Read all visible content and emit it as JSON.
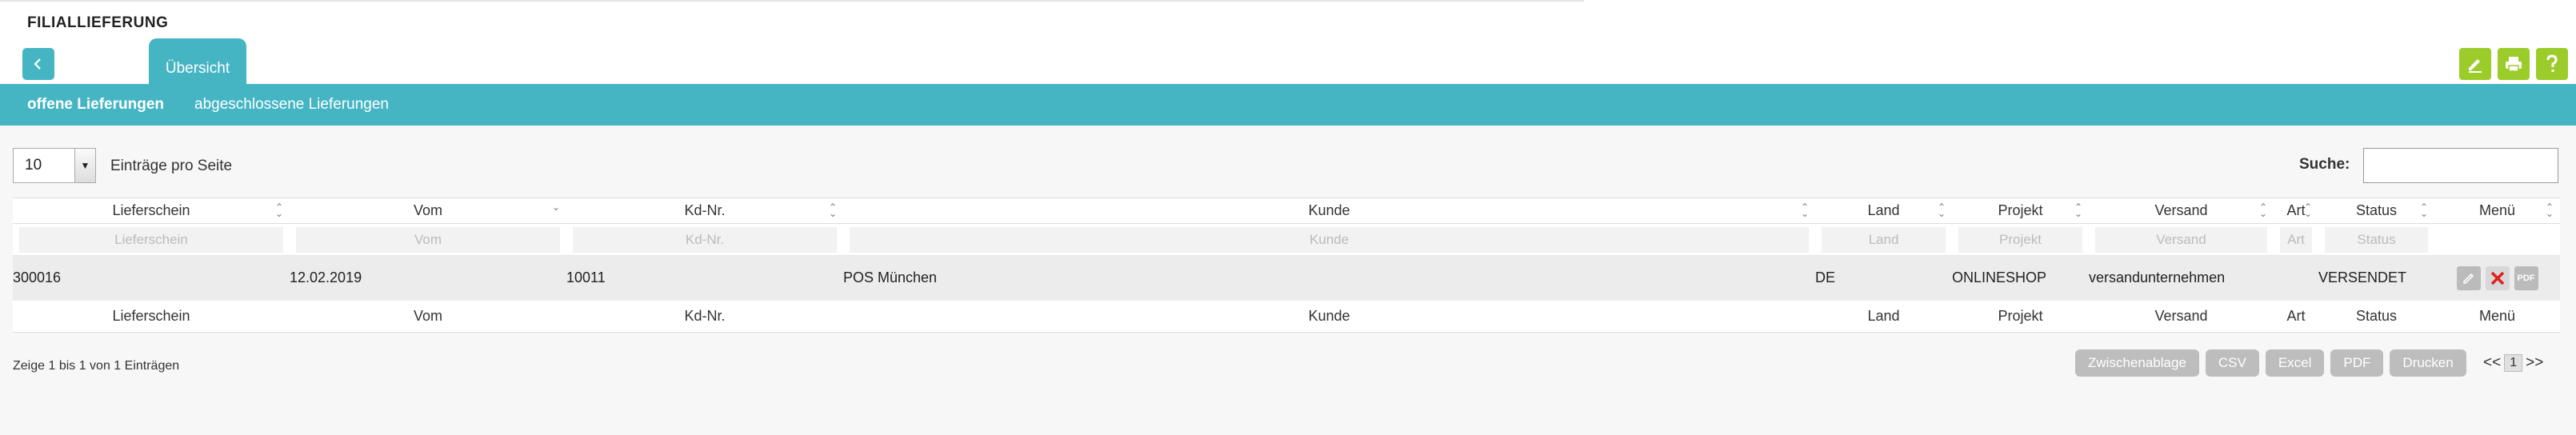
{
  "header": {
    "title": "FILIALLIEFERUNG",
    "tab_active": "Übersicht"
  },
  "top_icons": [
    "edit-icon",
    "print-icon",
    "help-icon"
  ],
  "subnav": {
    "open": "offene Lieferungen",
    "closed": "abgeschlossene Lieferungen"
  },
  "controls": {
    "page_length": "10",
    "page_length_label": "Einträge pro Seite",
    "search_label": "Suche:",
    "search_value": ""
  },
  "table": {
    "columns": [
      "Lieferschein",
      "Vom",
      "Kd-Nr.",
      "Kunde",
      "Land",
      "Projekt",
      "Versand",
      "Art",
      "Status",
      "Menü"
    ],
    "filters": [
      "Lieferschein",
      "Vom",
      "Kd-Nr.",
      "Kunde",
      "Land",
      "Projekt",
      "Versand",
      "Art",
      "Status"
    ],
    "rows": [
      {
        "lieferschein": "300016",
        "vom": "12.02.2019",
        "kdnr": "10011",
        "kunde": "POS München",
        "land": "DE",
        "projekt": "ONLINESHOP",
        "versand": "versandunternehmen",
        "art": "",
        "status": "VERSENDET",
        "pdf_label": "PDF"
      }
    ]
  },
  "footer": {
    "info": "Zeige 1 bis 1 von 1 Einträgen",
    "buttons": [
      "Zwischenablage",
      "CSV",
      "Excel",
      "PDF",
      "Drucken"
    ],
    "prev": "<<",
    "page": "1",
    "next": ">>"
  },
  "colors": {
    "accent": "#45b5c4",
    "icon_green": "#9ccc2a",
    "delete_red": "#e02020"
  }
}
